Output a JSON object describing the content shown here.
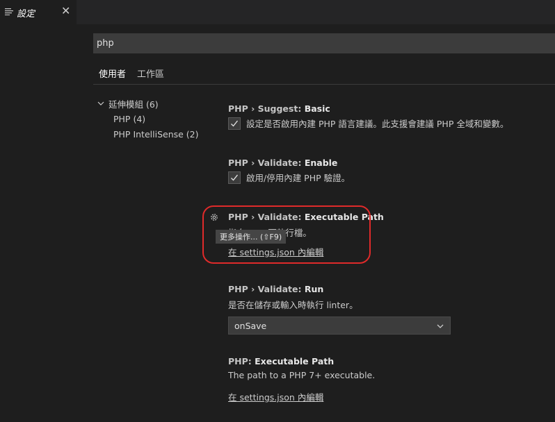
{
  "tab": {
    "title": "設定",
    "icon": "settings-list-icon",
    "close_label": "✕"
  },
  "search": {
    "value": "php",
    "placeholder": ""
  },
  "scope_tabs": [
    {
      "label": "使用者"
    },
    {
      "label": "工作區"
    }
  ],
  "toc": {
    "group": "延伸模組 (6)",
    "items": [
      {
        "label": "PHP (4)"
      },
      {
        "label": "PHP IntelliSense (2)"
      }
    ]
  },
  "settings": {
    "suggest_basic": {
      "category": "PHP › Suggest: ",
      "name": "Basic",
      "description": "設定是否啟用內建 PHP 語言建議。此支援會建議 PHP 全域和變數。",
      "checked": true
    },
    "validate_enable": {
      "category": "PHP › Validate: ",
      "name": "Enable",
      "description": "啟用/停用內建 PHP 驗證。",
      "checked": true
    },
    "validate_executable_path": {
      "category": "PHP › Validate: ",
      "name": "Executable Path",
      "description": "指向 PHP 可執行檔。",
      "link": "在 settings.json 內編輯",
      "tooltip": "更多操作... (⇧F9)"
    },
    "validate_run": {
      "category": "PHP › Validate: ",
      "name": "Run",
      "description": "是否在儲存或輸入時執行 linter。",
      "selected": "onSave"
    },
    "php_executable_path": {
      "category": "PHP: ",
      "name": "Executable Path",
      "description": "The path to a PHP 7+ executable.",
      "link": "在 settings.json 內編輯"
    }
  },
  "colors": {
    "highlight": "#e02a2a",
    "background": "#1e1e1e"
  }
}
